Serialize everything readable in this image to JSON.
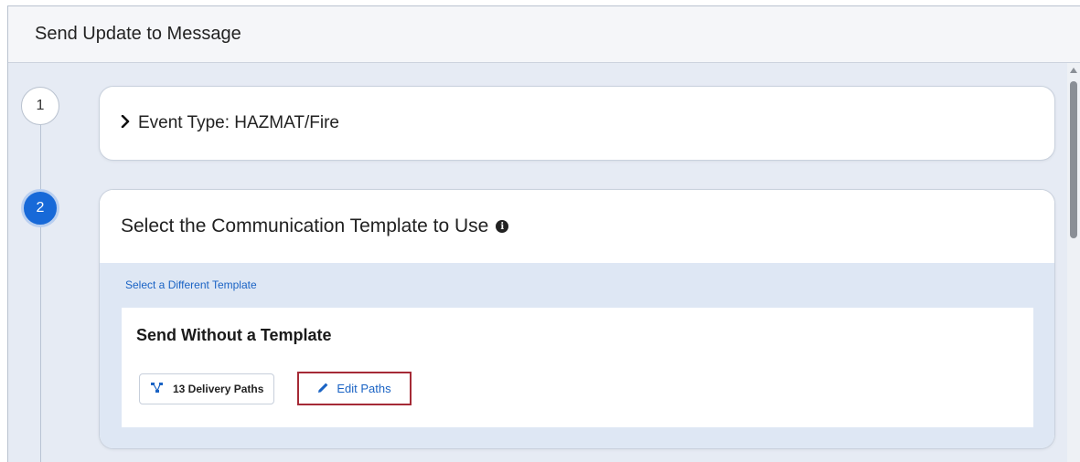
{
  "header": {
    "title": "Send Update to Message"
  },
  "steps": [
    {
      "number": "1",
      "title": "Event Type: HAZMAT/Fire",
      "state": "collapsed"
    },
    {
      "number": "2",
      "title": "Select the Communication Template to Use",
      "state": "active",
      "select_different_link": "Select a Different Template",
      "template": {
        "name": "Send Without a Template",
        "paths_label": "13 Delivery Paths",
        "edit_label": "Edit Paths"
      }
    }
  ],
  "colors": {
    "active_step": "#1769d8",
    "link": "#1a63c4",
    "highlight_border": "#a52a36",
    "panel_background": "#dee7f4"
  },
  "icons": {
    "expand": "chevron-right-icon",
    "info": "info-icon",
    "paths": "network-icon",
    "edit": "pencil-icon"
  }
}
